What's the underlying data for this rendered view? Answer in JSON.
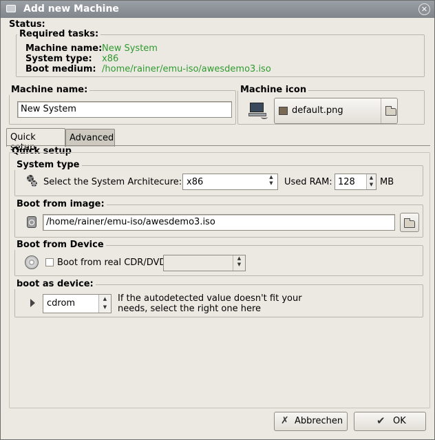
{
  "window": {
    "title": "Add new Machine"
  },
  "status": {
    "label": "Status:",
    "required_label": "Required tasks:",
    "rows": [
      {
        "key": "Machine name:",
        "value": "New System"
      },
      {
        "key": "System type:",
        "value": "x86"
      },
      {
        "key": "Boot medium:",
        "value": "/home/rainer/emu-iso/awesdemo3.iso"
      }
    ]
  },
  "machine_name": {
    "label": "Machine name:",
    "value": "New System"
  },
  "machine_icon": {
    "label": "Machine icon",
    "file": "default.png"
  },
  "tabs": [
    {
      "label": "Quick setup",
      "active": true
    },
    {
      "label": "Advanced",
      "active": false
    }
  ],
  "quick_setup": {
    "label": "Quick setup",
    "system_type": {
      "label": "System type",
      "arch_label": "Select the System Architecure:",
      "arch_value": "x86",
      "ram_label": "Used RAM:",
      "ram_value": "128",
      "ram_unit": "MB"
    },
    "boot_image": {
      "label": "Boot from image:",
      "path": "/home/rainer/emu-iso/awesdemo3.iso"
    },
    "boot_device": {
      "label": "Boot from Device",
      "checkbox_label": "Boot from real CDR/DVD",
      "checked": false,
      "device_value": ""
    },
    "boot_as": {
      "label": "boot as device:",
      "value": "cdrom",
      "hint_line1": "If the autodetected value doesn't fit your",
      "hint_line2": "needs, select the right one here"
    }
  },
  "buttons": {
    "cancel": "Abbrechen",
    "ok": "OK"
  }
}
